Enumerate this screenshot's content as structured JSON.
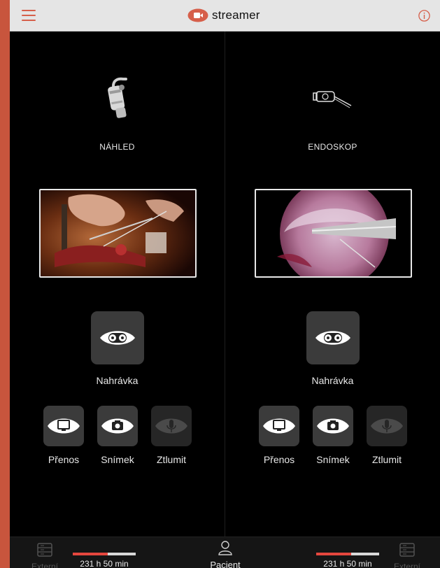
{
  "header": {
    "title": "streamer",
    "accent_color": "#d65f4a"
  },
  "panels": [
    {
      "device_label": "NÁHLED",
      "device_icon": "camera-head-icon",
      "record_label": "Nahrávka",
      "buttons": [
        {
          "label": "Přenos",
          "icon": "monitor-icon"
        },
        {
          "label": "Snímek",
          "icon": "camera-icon"
        },
        {
          "label": "Ztlumit",
          "icon": "microphone-icon"
        }
      ]
    },
    {
      "device_label": "ENDOSKOP",
      "device_icon": "endoscope-icon",
      "record_label": "Nahrávka",
      "buttons": [
        {
          "label": "Přenos",
          "icon": "monitor-icon"
        },
        {
          "label": "Snímek",
          "icon": "camera-icon"
        },
        {
          "label": "Ztlumit",
          "icon": "microphone-icon"
        }
      ]
    }
  ],
  "footer": {
    "external_left": "Externí",
    "external_right": "Externí",
    "storage_left": {
      "text": "231 h 50 min",
      "used_fraction": 0.55
    },
    "storage_right": {
      "text": "231 h 50 min",
      "used_fraction": 0.55
    },
    "patient_label": "Pacient"
  }
}
